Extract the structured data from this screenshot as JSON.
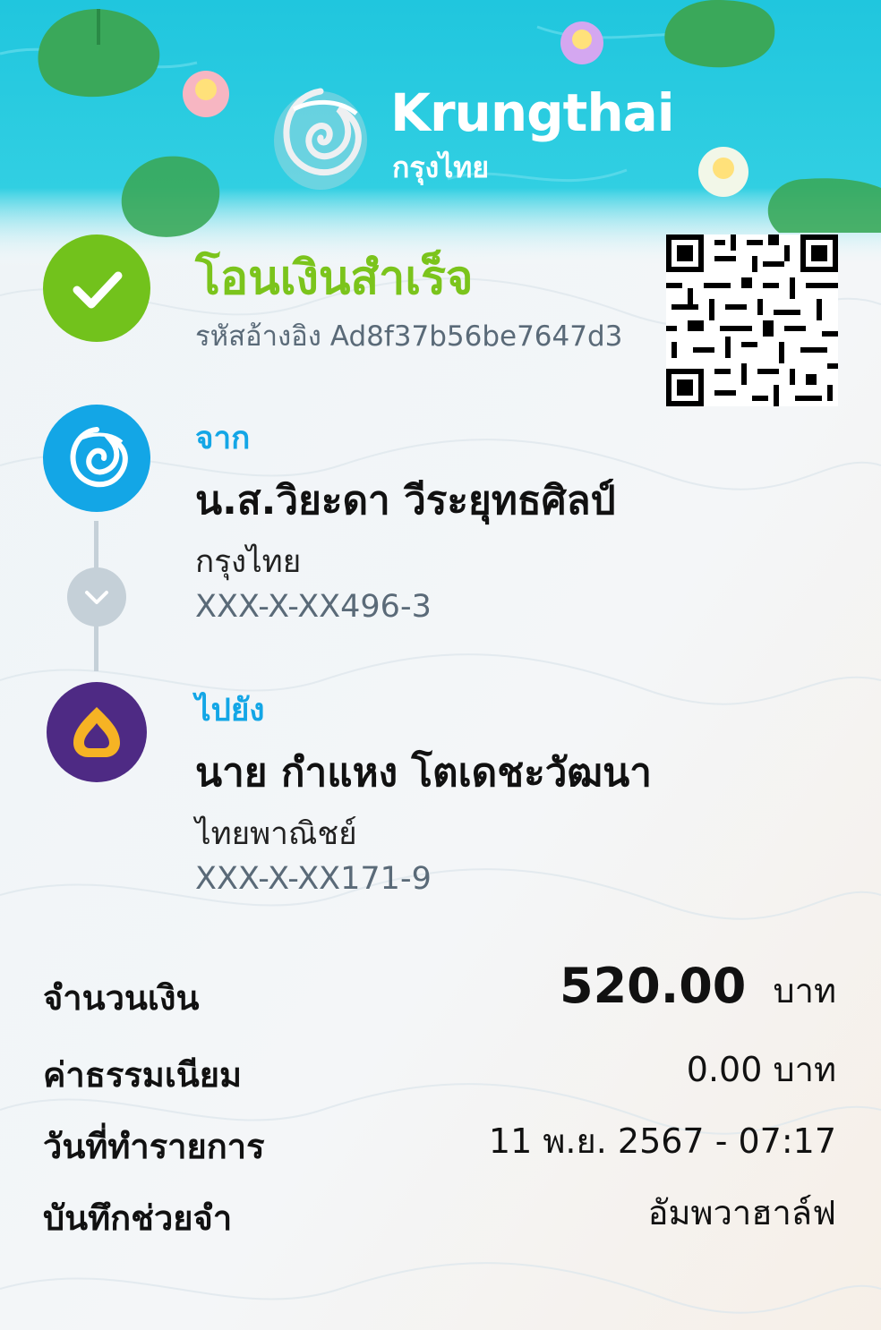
{
  "brand": {
    "name_en": "Krungthai",
    "name_th": "กรุงไทย"
  },
  "status": {
    "title": "โอนเงินสำเร็จ",
    "reference": "รหัสอ้างอิง Ad8f37b56be7647d3"
  },
  "sender": {
    "label": "จาก",
    "name": "น.ส.วิยะดา วีระยุทธศิลป์",
    "bank": "กรุงไทย",
    "account": "XXX-X-XX496-3"
  },
  "receiver": {
    "label": "ไปยัง",
    "name": "นาย กำแหง โตเดชะวัฒนา",
    "bank": "ไทยพาณิชย์",
    "account": "XXX-X-XX171-9"
  },
  "details": {
    "amount_label": "จำนวนเงิน",
    "amount_value": "520.00",
    "amount_unit": "บาท",
    "fee_label": "ค่าธรรมเนียม",
    "fee_value": "0.00 บาท",
    "date_label": "วันที่ทำรายการ",
    "date_value": "11 พ.ย. 2567 - 07:17",
    "memo_label": "บันทึกช่วยจำ",
    "memo_value": "อัมพวาฮาล์ฟ"
  },
  "colors": {
    "success_green": "#7bc41c",
    "brand_blue": "#13a6e6",
    "scb_purple": "#4e2a84",
    "header_cyan": "#1fc4dc"
  },
  "icons": [
    "check-icon",
    "krungthai-bird-logo",
    "chevron-down-icon",
    "scb-logo",
    "qr-code"
  ]
}
